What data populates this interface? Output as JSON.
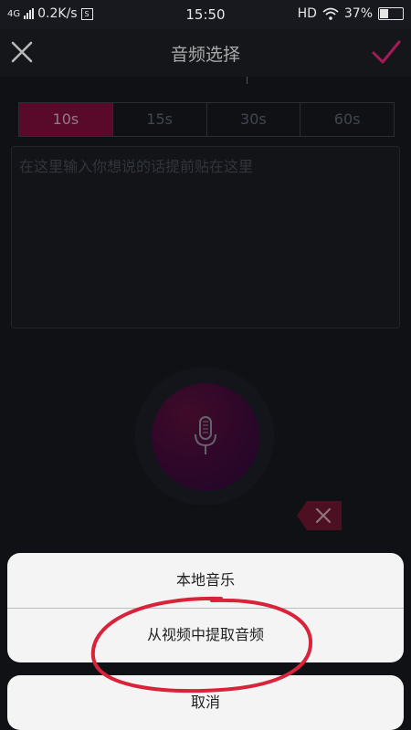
{
  "status_bar": {
    "network": "4G",
    "speed": "0.2K/s",
    "speed_icon_label": "S",
    "time": "15:50",
    "hd": "HD",
    "battery": "37%",
    "battery_level": 0.37
  },
  "header": {
    "title": "音频选择",
    "close_icon": "close-icon",
    "confirm_icon": "check-icon",
    "confirm_color": "#e6247a"
  },
  "duration_tabs": [
    {
      "label": "10s",
      "active": true
    },
    {
      "label": "15s",
      "active": false
    },
    {
      "label": "30s",
      "active": false
    },
    {
      "label": "60s",
      "active": false
    }
  ],
  "text_input": {
    "placeholder": "在这里输入你想说的话提前贴在这里"
  },
  "mic": {
    "icon": "microphone-icon"
  },
  "delete_key": {
    "icon": "backspace-icon"
  },
  "action_sheet": {
    "options": [
      {
        "label": "本地音乐"
      },
      {
        "label": "从视频中提取音频"
      }
    ],
    "cancel_label": "取消"
  },
  "annotation": {
    "color": "#d8233a"
  }
}
